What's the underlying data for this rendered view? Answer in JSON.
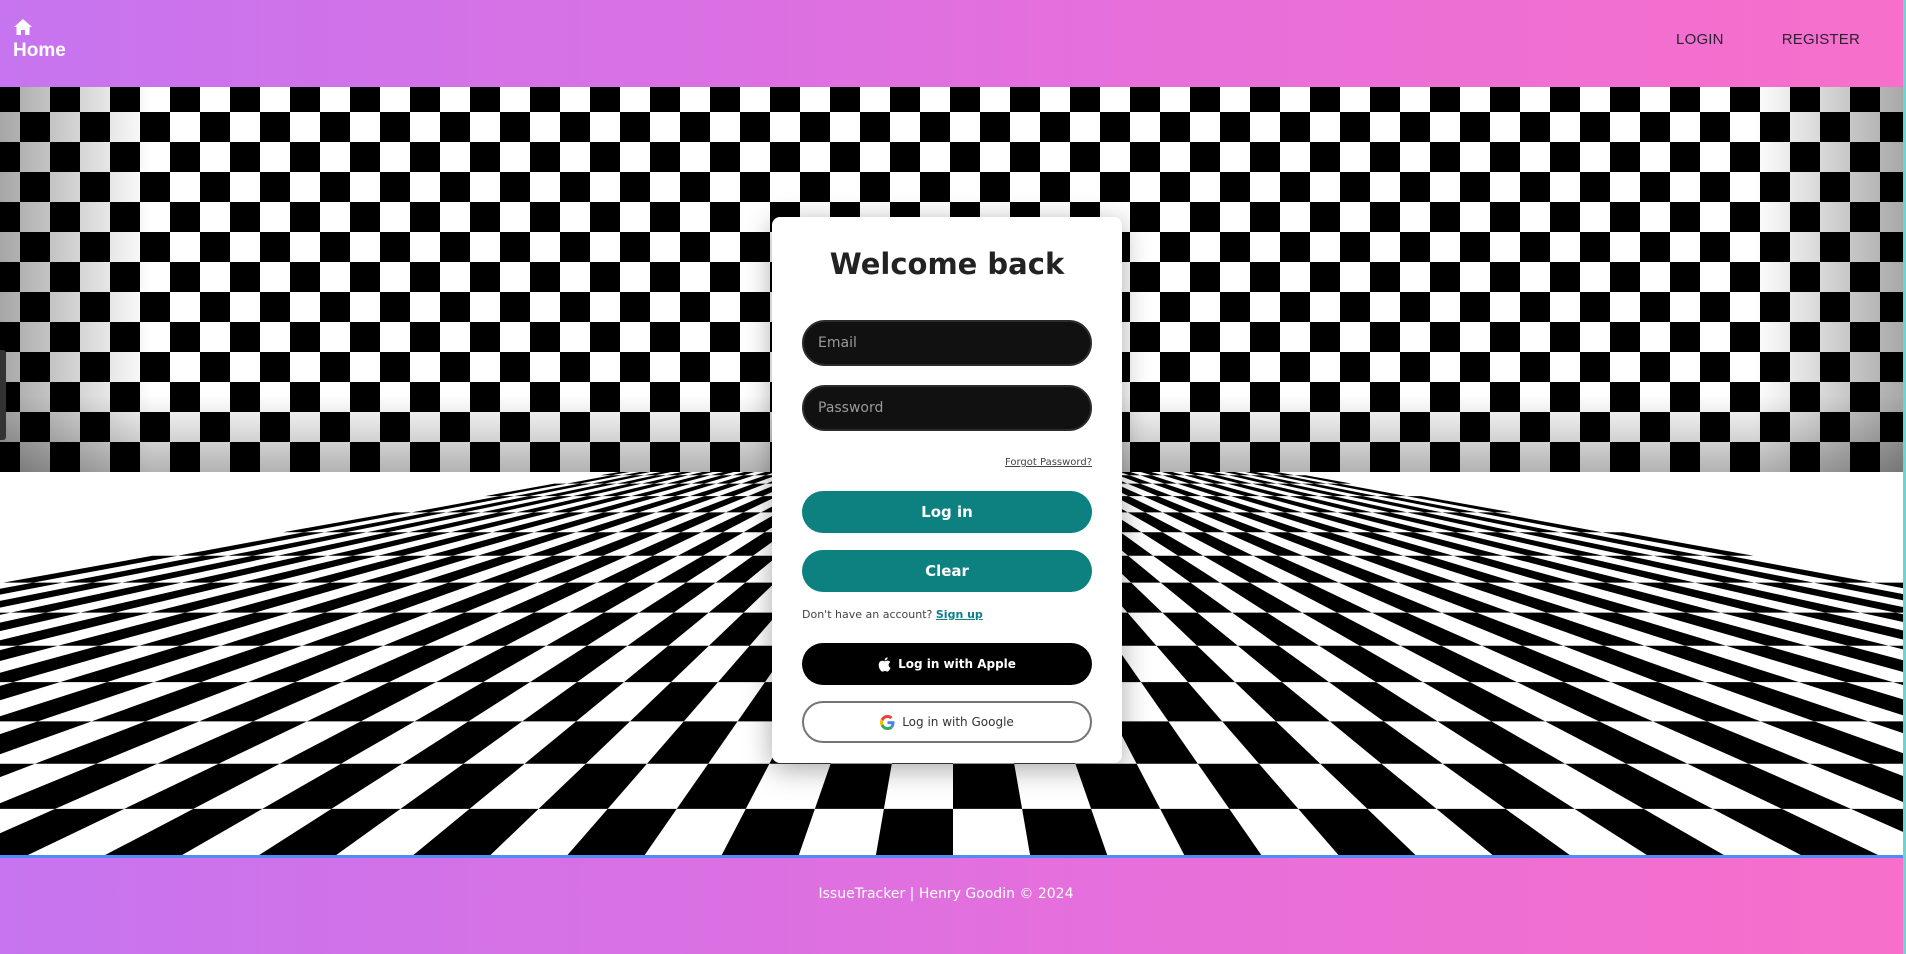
{
  "nav": {
    "home_label": "Home",
    "links": [
      "LOGIN",
      "REGISTER"
    ]
  },
  "login": {
    "title": "Welcome back",
    "email_placeholder": "Email",
    "password_placeholder": "Password",
    "forgot_label": "Forgot Password?",
    "login_button": "Log in",
    "clear_button": "Clear",
    "signup_prompt": "Don't have an account?",
    "signup_link": "Sign up",
    "apple_button": "Log in with Apple",
    "google_button": "Log in with Google"
  },
  "footer": {
    "text": "IssueTracker | Henry Goodin © 2024"
  },
  "colors": {
    "gradient_start": "#c674ef",
    "gradient_end": "#f76fca",
    "teal_button": "#0d8080",
    "input_bg": "#111111"
  }
}
